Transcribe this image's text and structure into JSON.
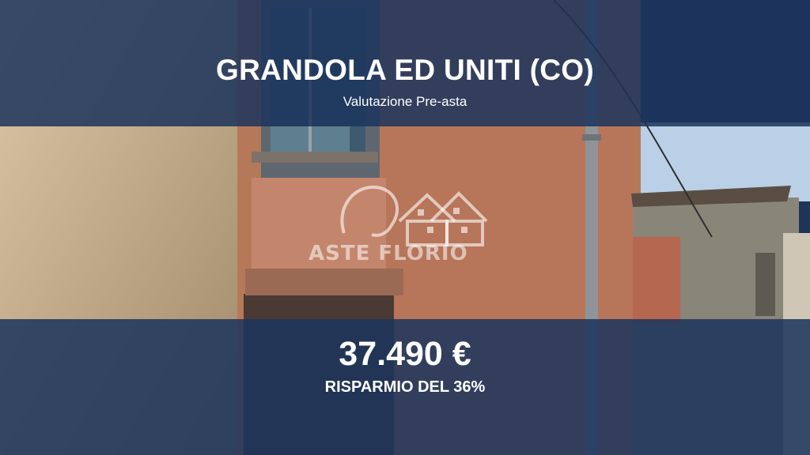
{
  "listing": {
    "location": "GRANDOLA ED UNITI (CO)",
    "subtitle": "Valutazione Pre-asta",
    "price": "37.490 €",
    "savings": "RISPARMIO DEL 36%"
  },
  "watermark": {
    "brand": "ASTE FLORIO",
    "icon": "lion-and-houses-logo"
  },
  "colors": {
    "band": "#1c345c",
    "text": "#ffffff"
  }
}
